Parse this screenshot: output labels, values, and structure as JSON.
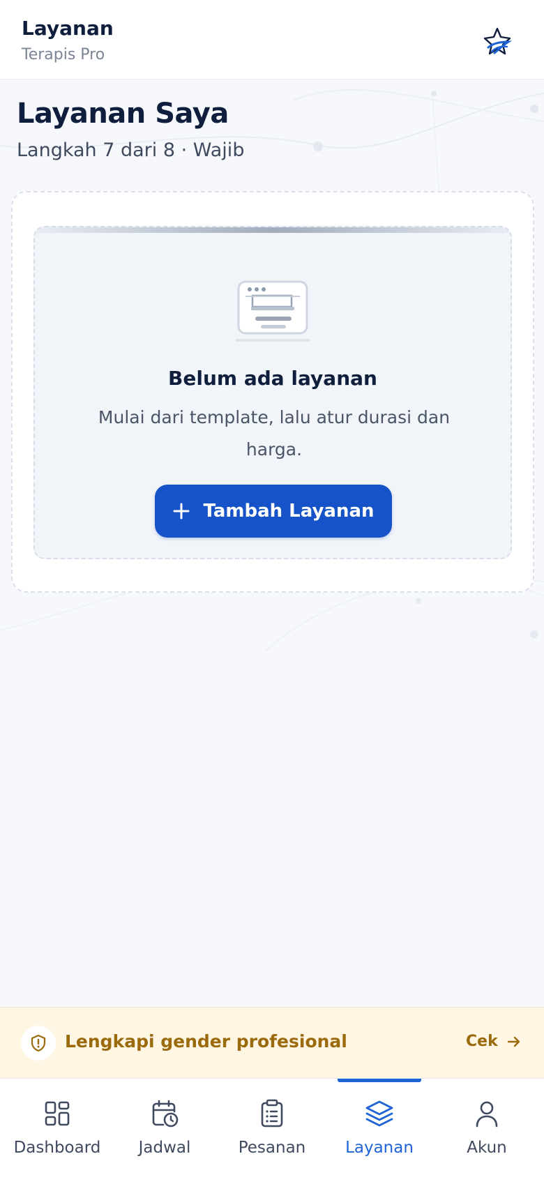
{
  "header": {
    "title": "Layanan",
    "subtitle": "Terapis Pro",
    "logo_icon": "lotus-star-icon"
  },
  "page": {
    "title": "Layanan Saya",
    "step_text": "Langkah 7 dari 8 · Wajib"
  },
  "empty_state": {
    "illustration_icon": "laptop-empty-icon",
    "title": "Belum ada layanan",
    "description": "Mulai dari template, lalu atur durasi dan harga.",
    "button_label": "Tambah Layanan",
    "button_icon": "plus-icon"
  },
  "notice": {
    "icon": "shield-alert-icon",
    "text": "Lengkapi gender profesional",
    "action_label": "Cek",
    "action_icon": "arrow-right-icon",
    "color": "#9a6a0c",
    "background": "#fff6e3"
  },
  "bottom_nav": {
    "items": [
      {
        "label": "Dashboard",
        "icon": "dashboard-grid-icon",
        "active": false
      },
      {
        "label": "Jadwal",
        "icon": "calendar-clock-icon",
        "active": false
      },
      {
        "label": "Pesanan",
        "icon": "clipboard-list-icon",
        "active": false
      },
      {
        "label": "Layanan",
        "icon": "layers-icon",
        "active": true
      },
      {
        "label": "Akun",
        "icon": "user-icon",
        "active": false
      }
    ],
    "active_color": "#1f63d6"
  },
  "colors": {
    "primary": "#1652c8",
    "text_dark": "#0f1e3d",
    "text_muted": "#7b8596"
  }
}
